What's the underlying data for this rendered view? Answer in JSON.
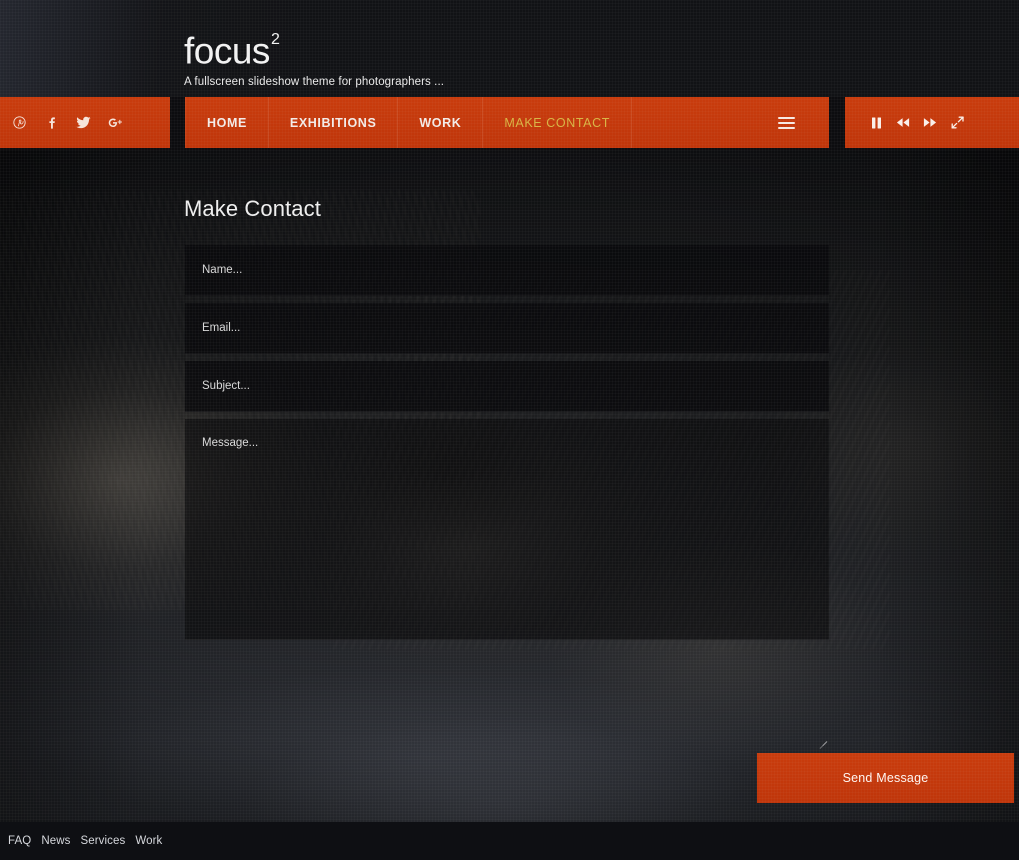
{
  "site": {
    "logo_text": "focus",
    "logo_superscript": "2",
    "tagline": "A fullscreen slideshow theme for photographers  ..."
  },
  "colors": {
    "accent_orange": "#c4380b",
    "active_link": "#d8b545",
    "page_background": "#0c0c0f",
    "field_background": "#09090b",
    "footer_background": "#0e0f13"
  },
  "social": {
    "items": [
      {
        "name": "pinterest-icon",
        "label": "Pinterest"
      },
      {
        "name": "facebook-icon",
        "label": "Facebook"
      },
      {
        "name": "twitter-icon",
        "label": "Twitter"
      },
      {
        "name": "google-plus-icon",
        "label": "Google Plus"
      }
    ]
  },
  "nav": {
    "items": [
      {
        "label": "HOME",
        "active": false
      },
      {
        "label": "EXHIBITIONS",
        "active": false
      },
      {
        "label": "WORK",
        "active": false
      },
      {
        "label": "MAKE CONTACT",
        "active": true
      }
    ],
    "menu_icon": "hamburger-menu-icon"
  },
  "slideshow_controls": {
    "items": [
      {
        "name": "pause-icon",
        "label": "Pause"
      },
      {
        "name": "previous-icon",
        "label": "Previous"
      },
      {
        "name": "next-icon",
        "label": "Next"
      },
      {
        "name": "fullscreen-icon",
        "label": "Fullscreen"
      }
    ]
  },
  "main": {
    "title": "Make Contact",
    "form": {
      "name_placeholder": "Name...",
      "name_value": "",
      "email_placeholder": "Email...",
      "email_value": "",
      "subject_placeholder": "Subject...",
      "subject_value": "",
      "message_placeholder": "Message...",
      "message_value": "",
      "submit_label": "Send Message"
    }
  },
  "footer": {
    "links": [
      {
        "label": "FAQ"
      },
      {
        "label": "News"
      },
      {
        "label": "Services"
      },
      {
        "label": "Work"
      }
    ]
  }
}
